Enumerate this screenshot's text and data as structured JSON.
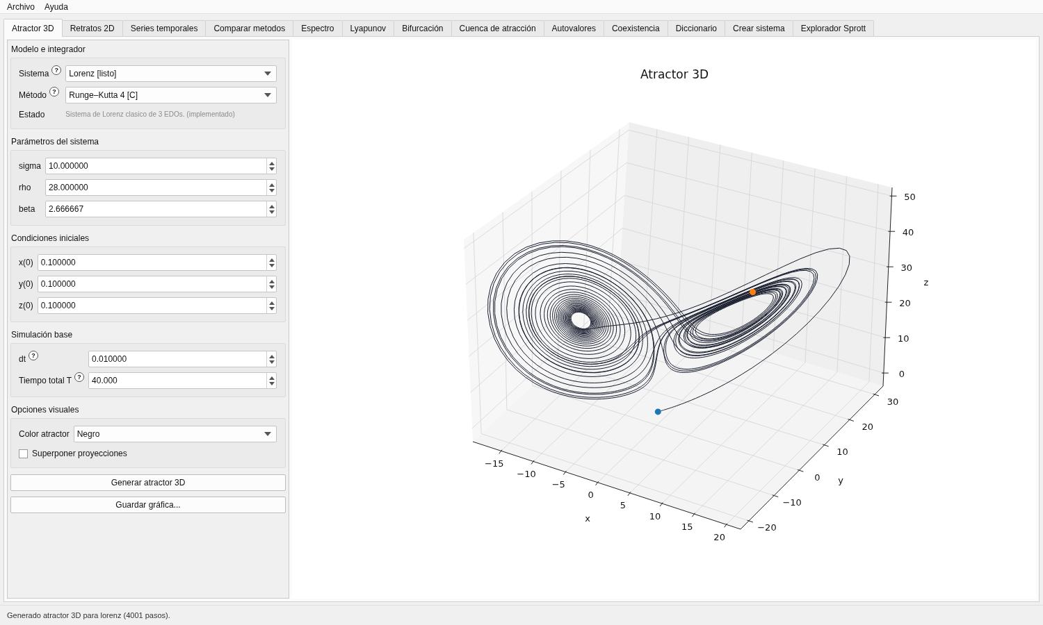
{
  "menu": [
    "Archivo",
    "Ayuda"
  ],
  "tabs": [
    {
      "label": "Atractor 3D",
      "selected": true
    },
    {
      "label": "Retratos 2D",
      "selected": false
    },
    {
      "label": "Series temporales",
      "selected": false
    },
    {
      "label": "Comparar metodos",
      "selected": false
    },
    {
      "label": "Espectro",
      "selected": false
    },
    {
      "label": "Lyapunov",
      "selected": false
    },
    {
      "label": "Bifurcación",
      "selected": false
    },
    {
      "label": "Cuenca de atracción",
      "selected": false
    },
    {
      "label": "Autovalores",
      "selected": false
    },
    {
      "label": "Coexistencia",
      "selected": false
    },
    {
      "label": "Diccionario",
      "selected": false
    },
    {
      "label": "Crear sistema",
      "selected": false
    },
    {
      "label": "Explorador Sprott",
      "selected": false
    }
  ],
  "groups": [
    {
      "title": "Modelo e integrador",
      "rows": [
        {
          "kind": "combo",
          "label": "Sistema",
          "help": "?",
          "value": "Lorenz [listo]"
        },
        {
          "kind": "combo",
          "label": "Método",
          "help": "?",
          "value": "Runge–Kutta 4 [C]"
        },
        {
          "kind": "info",
          "label": "Estado",
          "value": "Sistema de Lorenz clasico de 3 EDOs. (implementado)"
        }
      ]
    },
    {
      "title": "Parámetros del sistema",
      "rows": [
        {
          "kind": "spin",
          "label": "sigma",
          "value": "10.000000"
        },
        {
          "kind": "spin",
          "label": "rho",
          "value": "28.000000"
        },
        {
          "kind": "spin",
          "label": "beta",
          "value": "2.666667"
        }
      ]
    },
    {
      "title": "Condiciones iniciales",
      "rows": [
        {
          "kind": "spin",
          "label": "x(0)",
          "value": "0.100000"
        },
        {
          "kind": "spin",
          "label": "y(0)",
          "value": "0.100000"
        },
        {
          "kind": "spin",
          "label": "z(0)",
          "value": "0.100000"
        }
      ]
    },
    {
      "title": "Simulación base",
      "rows": [
        {
          "kind": "spin",
          "label": "dt",
          "help": "?",
          "value": "0.010000"
        },
        {
          "kind": "spin",
          "label": "Tiempo total T",
          "help": "?",
          "value": "40.000"
        }
      ]
    },
    {
      "title": "Opciones visuales",
      "rows": [
        {
          "kind": "combo",
          "label": "Color atractor",
          "value": "Negro"
        },
        {
          "kind": "check",
          "label": "Superponer proyecciones",
          "checked": false
        }
      ]
    }
  ],
  "buttons": [
    "Generar atractor 3D",
    "Guardar gráfica..."
  ],
  "plot": {
    "title": "Atractor 3D",
    "x_label": "x",
    "y_label": "y",
    "z_label": "z",
    "x_ticks": [
      "−15",
      "−10",
      "−5",
      "0",
      "5",
      "10",
      "15",
      "20"
    ],
    "y_ticks": [
      "30",
      "20",
      "10",
      "0",
      "−10",
      "−20"
    ],
    "z_ticks": [
      "50",
      "40",
      "30",
      "20",
      "10",
      "0"
    ]
  },
  "status_bar": "Generado atractor 3D para lorenz (4001 pasos)."
}
